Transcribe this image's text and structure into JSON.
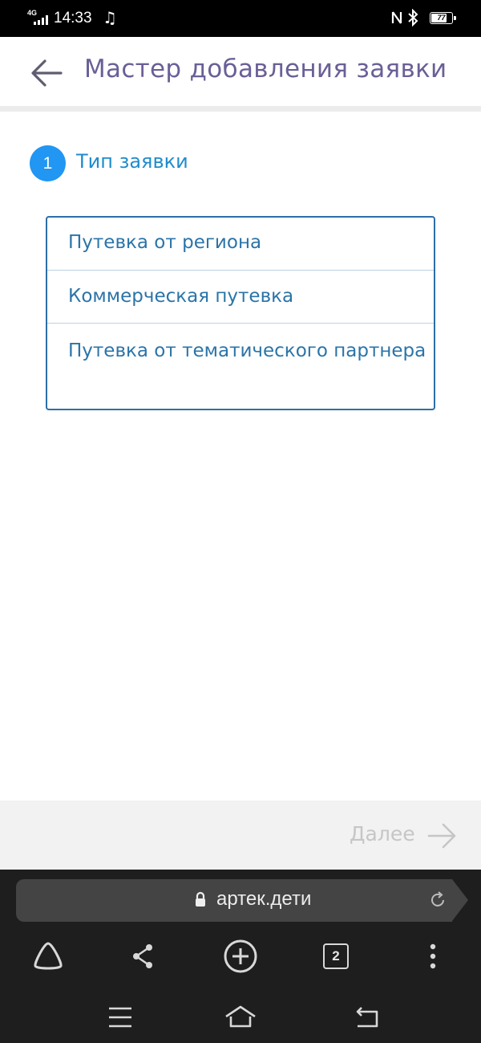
{
  "status_bar": {
    "network": "4G",
    "time": "14:33",
    "battery": "77",
    "battery_level": 0.77
  },
  "header": {
    "title": "Мастер добавления заявки"
  },
  "step": {
    "number": "1",
    "title": "Тип заявки"
  },
  "options": [
    {
      "label": "Путевка от региона"
    },
    {
      "label": "Коммерческая путевка"
    },
    {
      "label": "Путевка от тематического партнера"
    }
  ],
  "footer": {
    "next_label": "Далее"
  },
  "browser": {
    "url": "артек.дети",
    "tab_count": "2"
  },
  "colors": {
    "title": "#6b5f97",
    "accent": "#2196f3",
    "option_text": "#2b74a8",
    "disabled": "#c6c6c6"
  }
}
